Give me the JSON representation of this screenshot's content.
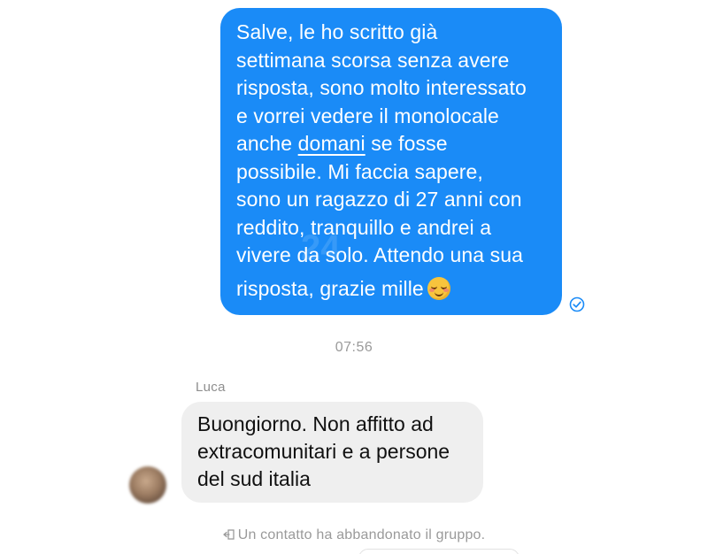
{
  "outgoing_message": {
    "lines": [
      "Salve, le ho scritto già",
      "settimana scorsa senza avere",
      "risposta, sono molto interessato",
      "e vorrei vedere il monolocale",
      "anche ",
      "domani",
      " se fosse",
      "possibile. Mi faccia sapere,",
      "sono un ragazzo di 27 anni con",
      "reddito, tranquillo e andrei a",
      "vivere da solo. Attendo una sua",
      "risposta, grazie mille"
    ],
    "emoji": "smiling-face-with-blush",
    "status_icon": "read-check-icon",
    "watermark_text": "24",
    "bubble_color": "#1a8bf7"
  },
  "timestamp": "07:56",
  "incoming_message": {
    "sender": "Luca",
    "lines": [
      "Buongiorno. Non affitto ad",
      "extracomunitari e a persone",
      "del sud italia"
    ],
    "bubble_color": "#efefef"
  },
  "system_message": {
    "icon": "leave-group-icon",
    "text": "Un contatto ha abbandonato il gruppo."
  }
}
